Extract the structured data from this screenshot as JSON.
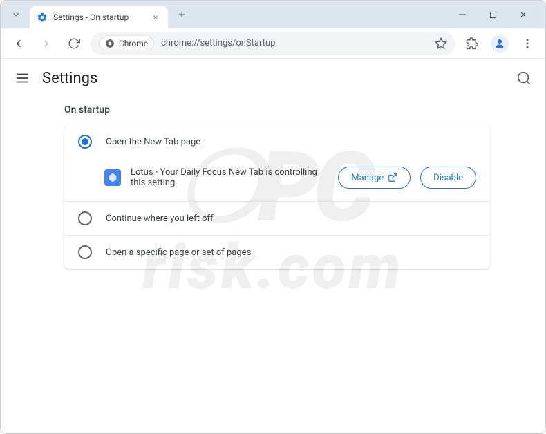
{
  "browser": {
    "tab_title": "Settings - On startup",
    "omnibox_chip": "Chrome",
    "url": "chrome://settings/onStartup"
  },
  "settings": {
    "title": "Settings",
    "section_title": "On startup",
    "options": {
      "new_tab": "Open the New Tab page",
      "continue": "Continue where you left off",
      "specific": "Open a specific page or set of pages"
    },
    "extension_notice": "Lotus - Your Daily Focus New Tab is controlling this setting",
    "manage_btn": "Manage",
    "disable_btn": "Disable"
  }
}
